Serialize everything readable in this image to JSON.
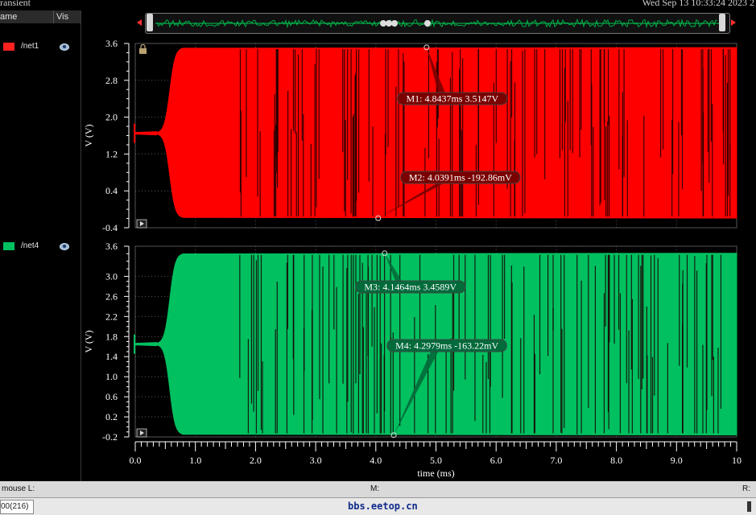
{
  "window": {
    "title": "ransient",
    "datetime": "Wed Sep 13 10:33:24 2023  2"
  },
  "legend": {
    "col_name": "ame",
    "col_vis": "Vis",
    "items": [
      {
        "name": "/net1",
        "color": "#ff2020",
        "icon": "eye-icon"
      },
      {
        "name": "/net4",
        "color": "#00c060",
        "icon": "eye-icon"
      }
    ]
  },
  "status": {
    "mouse_label": "mouse L:",
    "middle_label": "M:",
    "right_label": "R:",
    "field_value": "00(216)",
    "watermark": "bbs.eetop.cn"
  },
  "chart_data": [
    {
      "type": "line",
      "series_name": "/net1",
      "color": "#ff0000",
      "ylabel": "V (V)",
      "ylim": [
        -0.4,
        3.6
      ],
      "yticks": [
        "3.6",
        "2.8",
        "2.0",
        "1.2",
        "0.4",
        "-0.4"
      ],
      "xlim": [
        0,
        10
      ],
      "grid": true,
      "waveform": {
        "initial_level": 1.65,
        "growth_start_ms": 0.35,
        "full_swing_ms": 0.8,
        "high": 3.51,
        "low": -0.19
      },
      "markers": [
        {
          "label": "M1: 4.8437ms 3.5147V",
          "x": 4.8437,
          "y": 3.5147
        },
        {
          "label": "M2: 4.0391ms -192.86mV",
          "x": 4.0391,
          "y": -0.19286
        }
      ]
    },
    {
      "type": "line",
      "series_name": "/net4",
      "color": "#00c060",
      "ylabel": "V (V)",
      "ylim": [
        -0.2,
        3.6
      ],
      "yticks": [
        "3.6",
        "3.0",
        "2.6",
        "2.2",
        "1.8",
        "1.4",
        "1.0",
        "0.6",
        "0.2",
        "-0.2"
      ],
      "xlim": [
        0,
        10
      ],
      "grid": true,
      "waveform": {
        "initial_level": 1.65,
        "growth_start_ms": 0.35,
        "full_swing_ms": 0.8,
        "high": 3.46,
        "low": -0.16
      },
      "markers": [
        {
          "label": "M3: 4.1464ms 3.4589V",
          "x": 4.1464,
          "y": 3.4589
        },
        {
          "label": "M4: 4.2979ms -163.22mV",
          "x": 4.2979,
          "y": -0.16322
        }
      ]
    }
  ],
  "xaxis": {
    "label": "time (ms)",
    "ticks": [
      "0.0",
      "1.0",
      "2.0",
      "3.0",
      "4.0",
      "5.0",
      "6.0",
      "7.0",
      "8.0",
      "9.0",
      "10"
    ]
  }
}
